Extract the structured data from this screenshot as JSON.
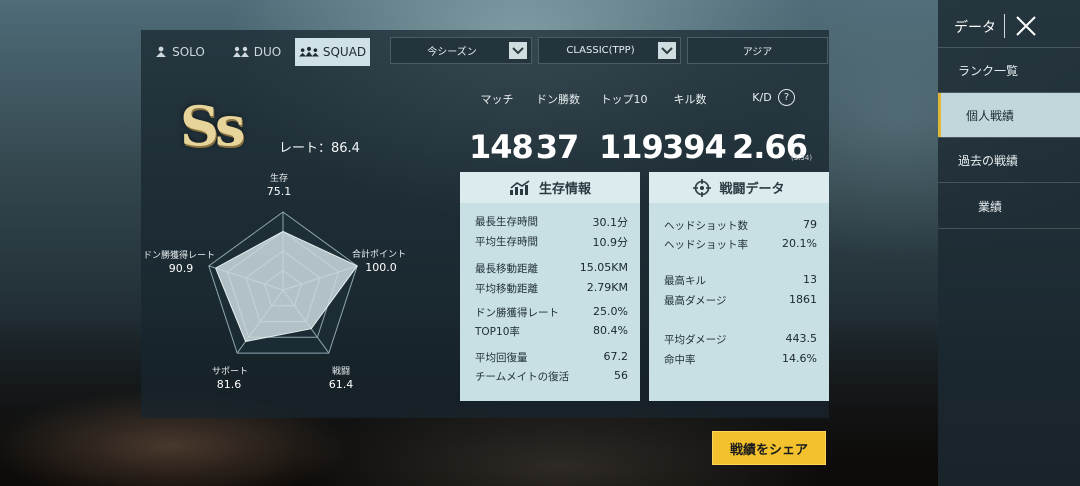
{
  "mode_tabs": [
    {
      "label": "SOLO",
      "icon": "solo-icon"
    },
    {
      "label": "DUO",
      "icon": "duo-icon"
    },
    {
      "label": "SQUAD",
      "icon": "squad-icon",
      "active": true
    }
  ],
  "filters": {
    "season": "今シーズン",
    "mode": "CLASSIC(TPP)",
    "region": "アジア"
  },
  "rank": {
    "badge_text": "Ss",
    "rate_label": "レート：86.4"
  },
  "stats": {
    "headers": [
      "マッチ",
      "ドン勝数",
      "トップ10",
      "キル数",
      "K/D"
    ],
    "values": [
      "148",
      "37",
      "119",
      "394",
      "2.66"
    ],
    "kd_sub": "(3.34)"
  },
  "radar": {
    "labels": {
      "survival": "生存",
      "total_points": "合計ポイント",
      "combat": "戦闘",
      "support": "サポート",
      "win_rate": "ドン勝獲得レート"
    },
    "values": {
      "survival": "75.1",
      "total_points": "100.0",
      "combat": "61.4",
      "support": "81.6",
      "win_rate": "90.9"
    },
    "scores": [
      75.1,
      100.0,
      61.4,
      81.6,
      90.9
    ]
  },
  "survival_card": {
    "title": "生存情報",
    "rows": [
      {
        "label": "最長生存時間",
        "value": "30.1分"
      },
      {
        "label": "平均生存時間",
        "value": "10.9分"
      },
      {
        "label": "最長移動距離",
        "value": "15.05KM"
      },
      {
        "label": "平均移動距離",
        "value": "2.79KM"
      },
      {
        "label": "ドン勝獲得レート",
        "value": "25.0%"
      },
      {
        "label": "TOP10率",
        "value": "80.4%"
      },
      {
        "label": "平均回復量",
        "value": "67.2"
      },
      {
        "label": "チームメイトの復活",
        "value": "56"
      }
    ]
  },
  "combat_card": {
    "title": "戦闘データ",
    "rows": [
      {
        "label": "ヘッドショット数",
        "value": "79"
      },
      {
        "label": "ヘッドショット率",
        "value": "20.1%"
      },
      {
        "label": "最高キル",
        "value": "13"
      },
      {
        "label": "最高ダメージ",
        "value": "1861"
      },
      {
        "label": "平均ダメージ",
        "value": "443.5"
      },
      {
        "label": "命中率",
        "value": "14.6%"
      }
    ]
  },
  "side_nav": {
    "title": "データ",
    "items": [
      {
        "label": "ランク一覧"
      },
      {
        "label": "個人戦績",
        "active": true
      },
      {
        "label": "過去の戦績"
      },
      {
        "label": "業績"
      }
    ]
  },
  "share_button": "戦績をシェア",
  "colors": {
    "accent_gold": "#f2c12d",
    "card_bg": "#c8dfe4",
    "active_tab_bg": "#cfe1e6"
  }
}
